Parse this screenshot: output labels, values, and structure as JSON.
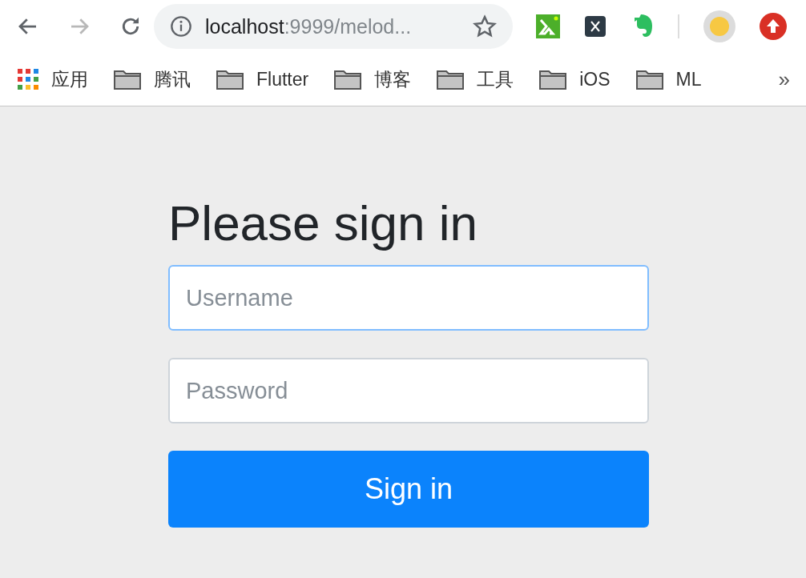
{
  "toolbar": {
    "back_enabled": true,
    "forward_enabled": false,
    "address": {
      "host": "localhost",
      "rest": ":9999/melod..."
    },
    "bookmarked": false
  },
  "bookmarks": {
    "items": [
      {
        "label": "应用",
        "kind": "apps"
      },
      {
        "label": "腾讯",
        "kind": "folder"
      },
      {
        "label": "Flutter",
        "kind": "folder"
      },
      {
        "label": "博客",
        "kind": "folder"
      },
      {
        "label": "工具",
        "kind": "folder"
      },
      {
        "label": "iOS",
        "kind": "folder"
      },
      {
        "label": "ML",
        "kind": "folder"
      }
    ],
    "overflow": "»"
  },
  "form": {
    "heading": "Please sign in",
    "fields": [
      {
        "placeholder": "Username",
        "focused": true
      },
      {
        "placeholder": "Password",
        "focused": false
      }
    ],
    "button": "Sign in"
  }
}
